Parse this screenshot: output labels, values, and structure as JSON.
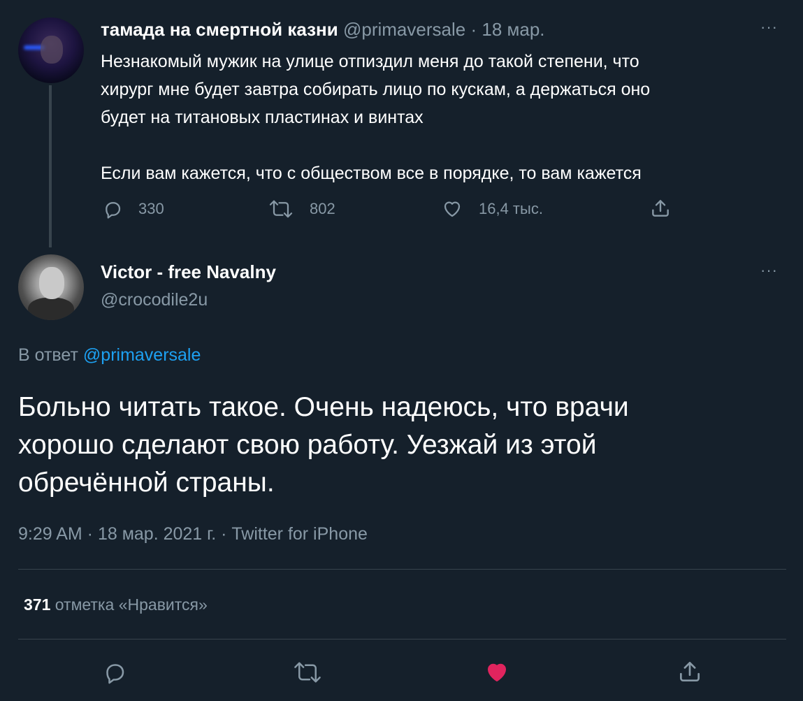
{
  "parent": {
    "name": "тамада на смертной казни",
    "handle": "@primaversale",
    "date": "18 мар.",
    "text": "Незнакомый мужик на улице отпиздил меня до такой степени, что\nхирург мне будет завтра собирать лицо по кускам, а держаться оно\nбудет на титановых пластинах и винтах\n\nЕсли вам кажется, что с обществом все в порядке, то вам кажется",
    "replies": "330",
    "retweets": "802",
    "likes": "16,4 тыс.",
    "more": "···"
  },
  "reply": {
    "name": "Victor - free Navalny",
    "handle": "@crocodile2u",
    "reply_label": "В ответ",
    "reply_to": "@primaversale",
    "text": "Больно читать такое. Очень надеюсь, что врачи\nхорошо сделают свою работу. Уезжай из этой\nобречённой страны.",
    "timestamp": "9:29 AM · 18 мар. 2021 г. · Twitter for iPhone",
    "like_count": "371",
    "like_label": "отметка «Нравится»",
    "more": "···"
  },
  "colors": {
    "background": "#15202b",
    "muted": "#8899a6",
    "link": "#1da1f2",
    "like_active": "#e0245e",
    "divider": "#38444d"
  },
  "icons": [
    "reply-icon",
    "retweet-icon",
    "like-icon",
    "share-icon",
    "more-icon"
  ]
}
